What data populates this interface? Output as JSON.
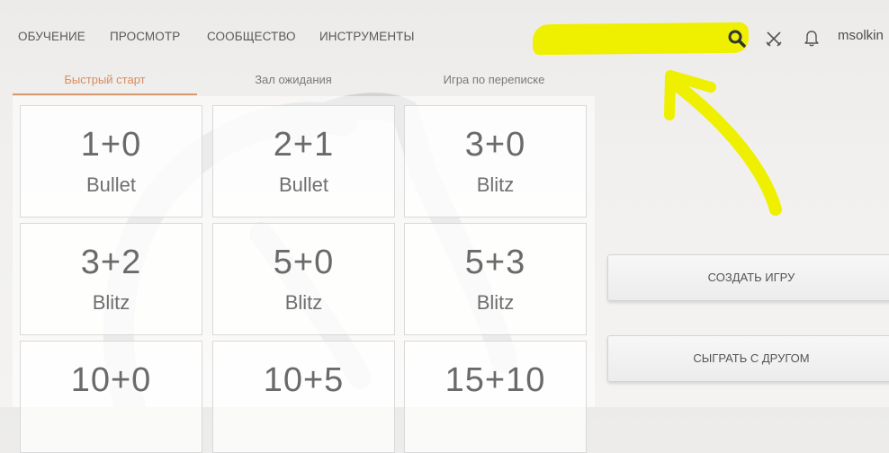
{
  "nav": {
    "items": [
      "ОБУЧЕНИЕ",
      "ПРОСМОТР",
      "СООБЩЕСТВО",
      "ИНСТРУМЕНТЫ"
    ],
    "username": "msolkin"
  },
  "icons": [
    "search-icon",
    "swords-icon",
    "bell-icon"
  ],
  "tabs": [
    "Быстрый старт",
    "Зал ожидания",
    "Игра по переписке"
  ],
  "active_tab": "Быстрый старт",
  "pools": [
    {
      "time": "1+0",
      "perf": "Bullet"
    },
    {
      "time": "2+1",
      "perf": "Bullet"
    },
    {
      "time": "3+0",
      "perf": "Blitz"
    },
    {
      "time": "3+2",
      "perf": "Blitz"
    },
    {
      "time": "5+0",
      "perf": "Blitz"
    },
    {
      "time": "5+3",
      "perf": "Blitz"
    },
    {
      "time": "10+0",
      "perf": ""
    },
    {
      "time": "10+5",
      "perf": ""
    },
    {
      "time": "15+10",
      "perf": ""
    }
  ],
  "buttons": {
    "create_game": "СОЗДАТЬ ИГРУ",
    "play_with_friend": "СЫГРАТЬ С ДРУГОМ"
  },
  "colors": {
    "accent": "#d88c5d",
    "highlight": "#eef000"
  }
}
